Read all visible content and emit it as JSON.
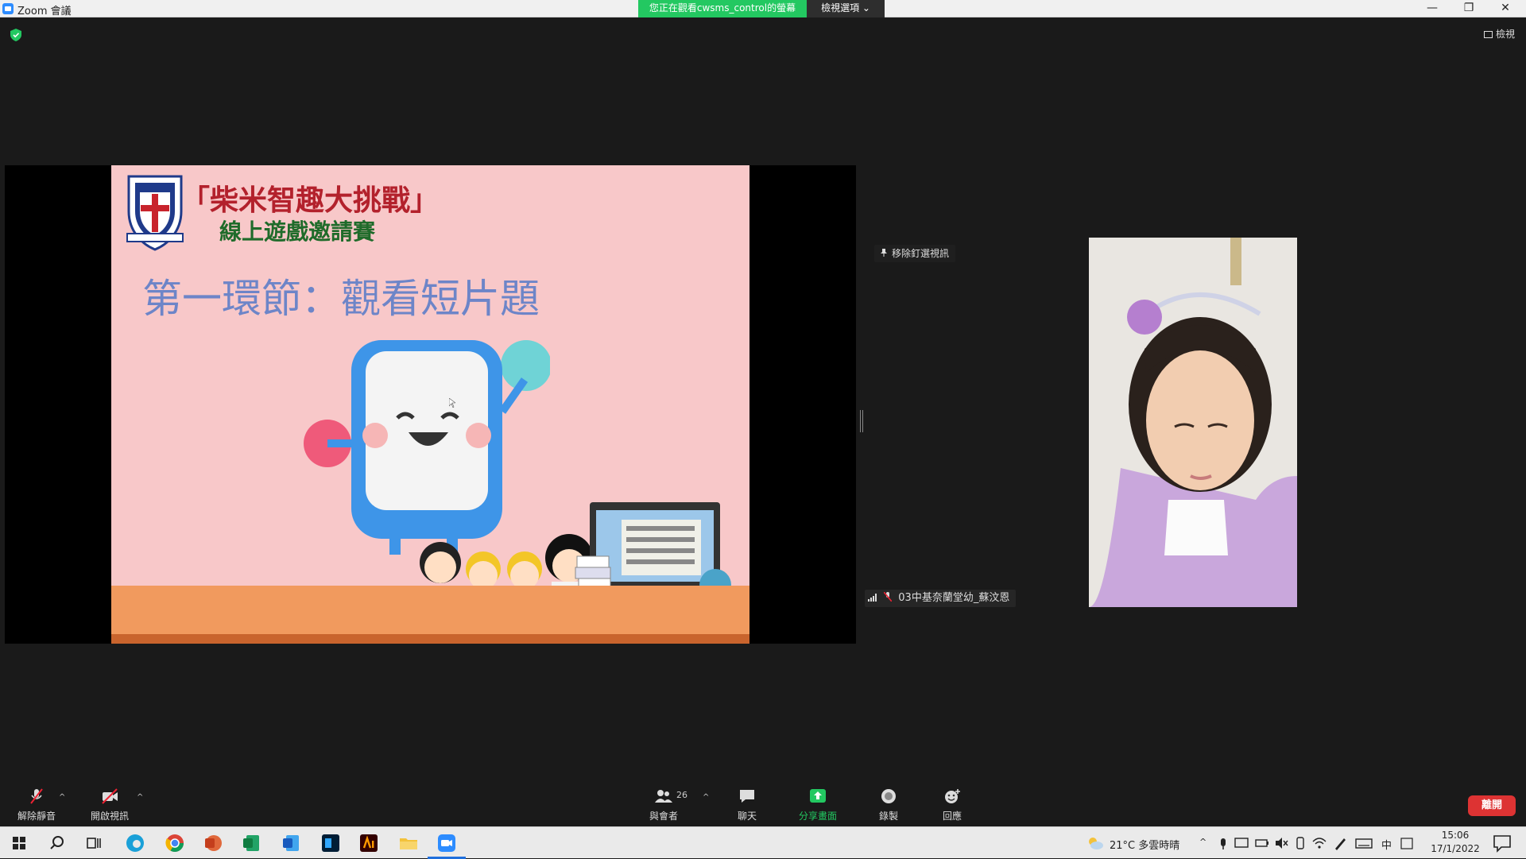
{
  "window": {
    "title": "Zoom 會議",
    "viewing_banner": "您正在觀看cwsms_control的螢幕",
    "view_options": "檢視選項 ⌄",
    "minimize": "—",
    "restore": "❐",
    "close": "✕"
  },
  "top_right": {
    "view_label": "檢視"
  },
  "slide": {
    "title_line1": "「柴米智趣大挑戰」",
    "title_line2": "線上遊戲邀請賽",
    "section_title": "第一環節：觀看短片題"
  },
  "pin_label": "移除釘選視訊",
  "participant": {
    "name": "03中基奈蘭堂幼_蘇汶恩"
  },
  "toolbar": {
    "unmute": "解除靜音",
    "start_video": "開啟視訊",
    "participants": "與會者",
    "participants_count": "26",
    "chat": "聊天",
    "share_screen": "分享畫面",
    "record": "錄製",
    "reactions": "回應",
    "end": "離開"
  },
  "taskbar": {
    "weather": "21°C  多雲時晴",
    "ime": "中",
    "time": "15:06",
    "date": "17/1/2022"
  },
  "colors": {
    "share_green": "#23c861",
    "end_red": "#dd3333",
    "zoom_blue": "#2d8cff",
    "slide_pink": "#f8c8c9"
  }
}
